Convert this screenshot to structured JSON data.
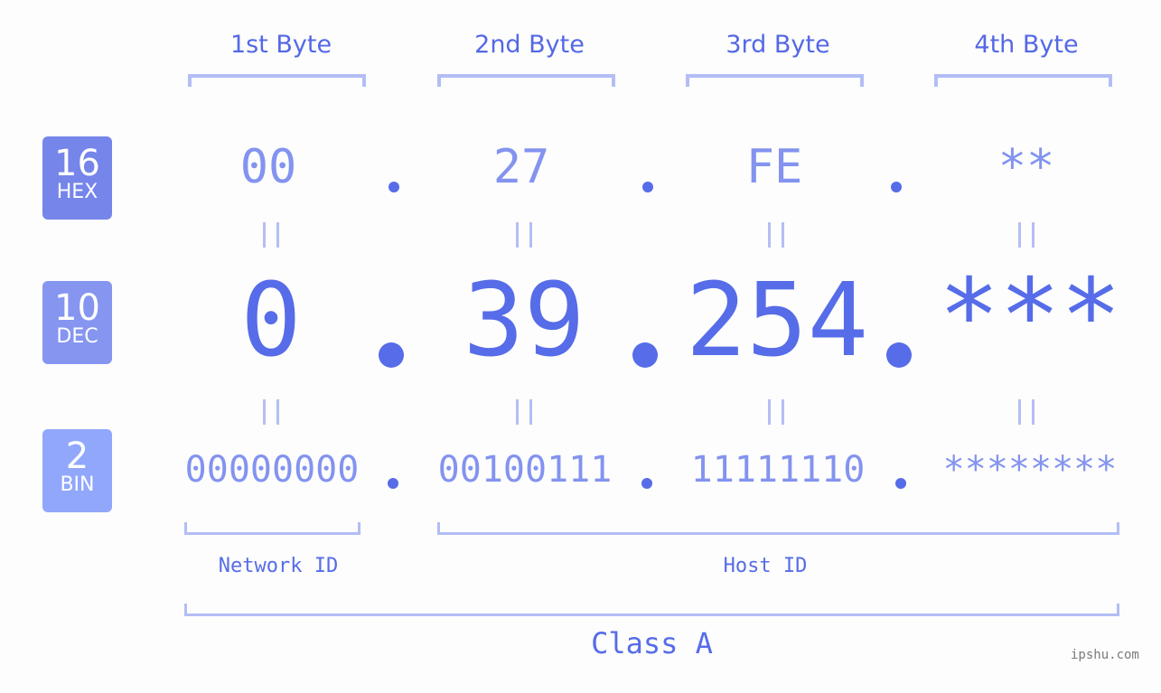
{
  "headers": [
    "1st Byte",
    "2nd Byte",
    "3rd Byte",
    "4th Byte"
  ],
  "badges": {
    "hex": {
      "base": "16",
      "label": "HEX",
      "color": "#7585ea"
    },
    "dec": {
      "base": "10",
      "label": "DEC",
      "color": "#8595f0"
    },
    "bin": {
      "base": "2",
      "label": "BIN",
      "color": "#91a7fb"
    }
  },
  "hex_values": [
    "00",
    "27",
    "FE",
    "**"
  ],
  "dec_values": [
    "0",
    "39",
    "254",
    "***"
  ],
  "bin_values": [
    "00000000",
    "00100111",
    "11111110",
    "********"
  ],
  "equals_sign": "=",
  "network_id_label": "Network ID",
  "host_id_label": "Host ID",
  "class_label": "Class A",
  "watermark": "ipshu.com",
  "colors": {
    "accent": "#566ce8",
    "light": "#b3bdf6",
    "mid": "#8393ef"
  }
}
